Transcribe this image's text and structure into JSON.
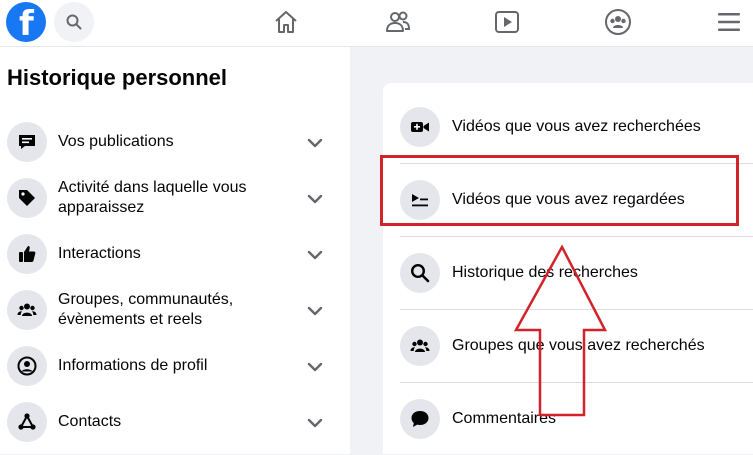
{
  "topbar": {
    "logo_letter": "f",
    "icons": [
      "facebook-logo",
      "search-icon",
      "home-icon",
      "friends-icon",
      "watch-icon",
      "groups-icon",
      "menu-icon"
    ]
  },
  "sidebar": {
    "title": "Historique personnel",
    "items": [
      {
        "label": "Vos publications",
        "icon": "post-icon"
      },
      {
        "label": "Activité dans laquelle vous apparaissez",
        "icon": "tag-icon"
      },
      {
        "label": "Interactions",
        "icon": "thumbs-up-icon"
      },
      {
        "label": "Groupes, communautés, évènements et reels",
        "icon": "group-icon"
      },
      {
        "label": "Informations de profil",
        "icon": "profile-icon"
      },
      {
        "label": "Contacts",
        "icon": "share-icon"
      }
    ]
  },
  "main": {
    "rows": [
      {
        "label": "Vidéos que vous avez recherchées",
        "icon": "video-camera-icon"
      },
      {
        "label": "Vidéos que vous avez regardées",
        "icon": "video-list-icon"
      },
      {
        "label": "Historique des recherches",
        "icon": "search-icon"
      },
      {
        "label": "Groupes que vous avez recherchés",
        "icon": "group-icon"
      },
      {
        "label": "Commentaires",
        "icon": "comment-icon"
      }
    ]
  },
  "annotation": {
    "highlight_color": "#d2232a",
    "highlighted_row": "Vidéos que vous avez regardées"
  },
  "colors": {
    "brand": "#1877f2",
    "page_bg": "#f0f2f5",
    "icon_circle": "#e4e6eb"
  }
}
